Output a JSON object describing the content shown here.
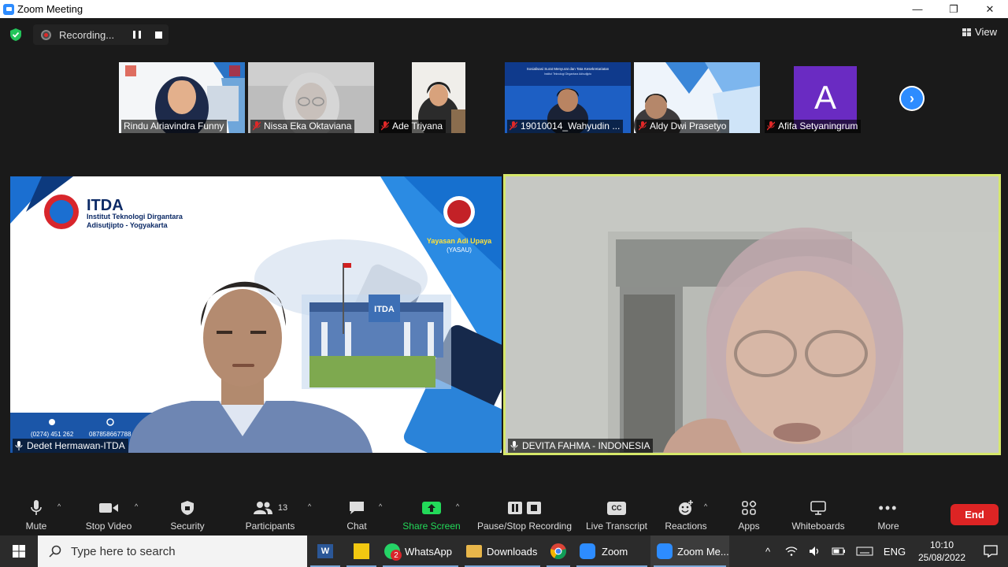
{
  "window": {
    "title": "Zoom Meeting",
    "controls": [
      "—",
      "❐",
      "✕"
    ]
  },
  "recording": {
    "label": "Recording..."
  },
  "view": {
    "label": "View"
  },
  "thumbnails": [
    {
      "name": "Rindu Alriavindra Funny",
      "muted": false
    },
    {
      "name": "Nissa Eka Oktaviana",
      "muted": true
    },
    {
      "name": "Ade Triyana",
      "muted": true
    },
    {
      "name": "19010014_Wahyudin ...",
      "muted": true
    },
    {
      "name": "Aldy Dwi Prasetyo",
      "muted": true
    },
    {
      "name": "Afifa Setyaningrum",
      "muted": true,
      "avatar_letter": "A"
    }
  ],
  "main_tiles": {
    "left": {
      "name": "Dedet Hermawan-ITDA",
      "background": {
        "brand": "ITDA",
        "institute_line1": "Institut Teknologi Dirgantara",
        "institute_line2": "Adisutjipto - Yogyakarta",
        "foundation_line1": "Yayasan Adi Upaya",
        "foundation_line2": "(YASAU)",
        "phone": "(0274) 451 262",
        "whatsapp": "087858667788",
        "building_sign": "ITDA"
      }
    },
    "right": {
      "name": "DEVITA FAHMA - INDONESIA"
    }
  },
  "thumb_slide_text": {
    "line1": "Sosialisasi Surat Menyurat dan Tata Kesekretariatan",
    "line2": "Institut Teknologi Dirgantara Adisutjipto"
  },
  "toolbar": {
    "mute": "Mute",
    "stop_video": "Stop Video",
    "security": "Security",
    "participants": "Participants",
    "participants_count": "13",
    "chat": "Chat",
    "share_screen": "Share Screen",
    "pause_stop_recording": "Pause/Stop Recording",
    "live_transcript": "Live Transcript",
    "cc_icon_text": "CC",
    "reactions": "Reactions",
    "apps": "Apps",
    "whiteboards": "Whiteboards",
    "more": "More",
    "end": "End"
  },
  "taskbar": {
    "search_placeholder": "Type here to search",
    "apps": [
      {
        "label": "WhatsApp",
        "badge": "2"
      },
      {
        "label": "Downloads"
      },
      {
        "label": "Zoom"
      },
      {
        "label": "Zoom Me..."
      }
    ],
    "language": "ENG",
    "time": "10:10",
    "date": "25/08/2022"
  },
  "colors": {
    "accent_blue": "#2d8cff",
    "share_green": "#23d959",
    "end_red": "#dd2424",
    "active_speaker_border": "#d6e86a"
  }
}
